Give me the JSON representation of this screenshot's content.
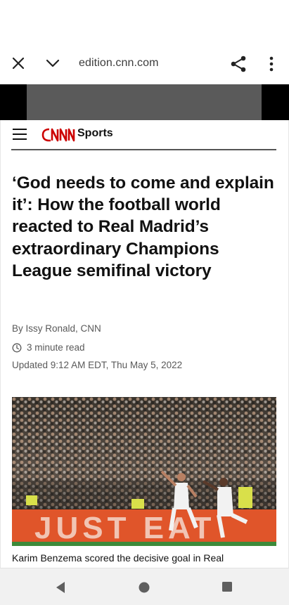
{
  "browser": {
    "url": "edition.cnn.com",
    "close_icon": "close-icon",
    "chevron_icon": "chevron-down-icon",
    "share_icon": "share-icon",
    "more_icon": "more-vert-icon"
  },
  "site": {
    "logo_text": "CNN",
    "section": "Sports",
    "brand_color": "#cc0000"
  },
  "article": {
    "headline": "‘God needs to come and explain it’: How the football world reacted to Real Madrid’s extraordinary Champions League semifinal victory",
    "byline": "By Issy Ronald, CNN",
    "read_time": "3 minute read",
    "updated": "Updated 9:12 AM EDT, Thu May 5, 2022",
    "photo_board_text": "JUST EAT",
    "caption": "Karim Benzema scored the decisive goal in Real"
  },
  "nav": {
    "back_icon": "back-triangle-icon",
    "home_icon": "home-circle-icon",
    "recents_icon": "recents-square-icon"
  }
}
